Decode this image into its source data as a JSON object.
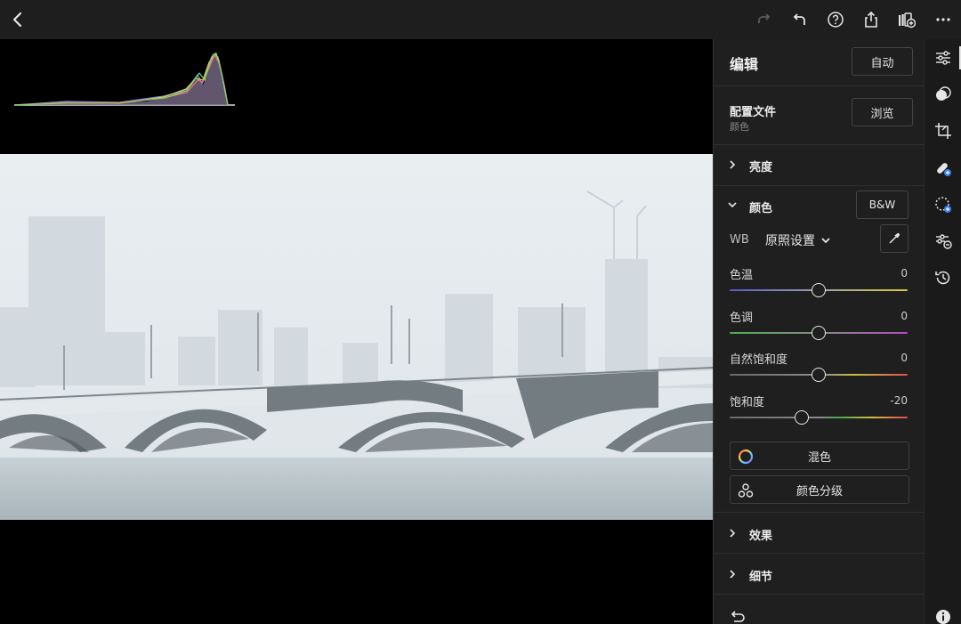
{
  "topbar": {
    "icons": [
      "back-icon",
      "redo-icon",
      "undo-icon",
      "help-icon",
      "share-icon",
      "add-to-album-icon",
      "more-icon"
    ]
  },
  "panel": {
    "title": "编辑",
    "auto_label": "自动",
    "profile": {
      "label": "配置文件",
      "value": "颜色",
      "browse_label": "浏览"
    },
    "sections": {
      "light": "亮度",
      "color": "颜色",
      "effects": "效果",
      "detail": "细节"
    },
    "bw_label": "B&W",
    "wb": {
      "label": "WB",
      "value": "原照设置"
    },
    "sliders": [
      {
        "label": "色温",
        "value": "0"
      },
      {
        "label": "色调",
        "value": "0"
      },
      {
        "label": "自然饱和度",
        "value": "0"
      },
      {
        "label": "饱和度",
        "value": "-20"
      }
    ],
    "mix_label": "混色",
    "grading_label": "颜色分级"
  },
  "rail": {
    "icons": [
      "edit-sliders-icon",
      "presets-icon",
      "crop-icon",
      "healing-icon",
      "masking-icon",
      "versions-icon",
      "history-icon",
      "info-icon"
    ]
  },
  "colors": {
    "panel_bg": "#1f1f1f",
    "topbar_bg": "#1e1e1e",
    "accent_blue": "#3b82f6"
  }
}
